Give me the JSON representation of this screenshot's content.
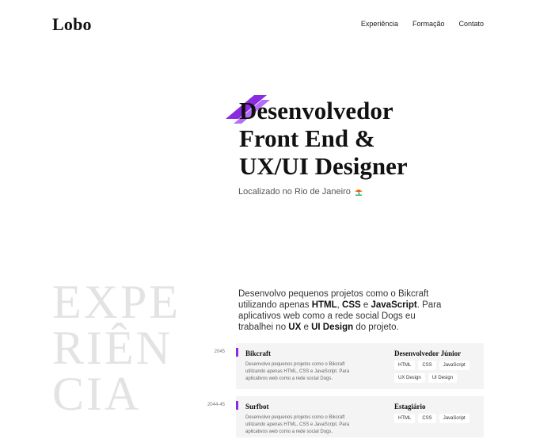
{
  "brand": {
    "logo": "Lobo"
  },
  "nav": {
    "items": [
      "Experiência",
      "Formação",
      "Contato"
    ]
  },
  "hero": {
    "title_lines": [
      "Desenvolvedor",
      "Front End &",
      "UX/UI Designer"
    ],
    "location": "Localizado no Rio de Janeiro",
    "accent_color": "#8a2be2"
  },
  "experience": {
    "heading_lines": [
      "EXPE",
      "RIÊN",
      "CIA"
    ],
    "intro": {
      "p1": "Desenvolvo pequenos projetos como o Bikcraft utilizando apenas ",
      "b1": "HTML",
      "p2": ", ",
      "b2": "CSS",
      "p3": " e ",
      "b3": "JavaScript",
      "p4": ". Para aplicativos web como a rede social Dogs eu trabalhei no ",
      "b4": "UX",
      "p5": " e ",
      "b5": "UI Design",
      "p6": " do projeto."
    },
    "jobs": [
      {
        "year": "2045",
        "company": "Bikcraft",
        "description": "Desenvolvo pequenos projetos como o Bikcraft utilizando apenas HTML, CSS e JavaScript. Para aplicativos web como a rede social Dogs.",
        "role": "Desenvolvedor Júnior",
        "tags": [
          "HTML",
          "CSS",
          "JavaScript",
          "UX Design",
          "UI Design"
        ]
      },
      {
        "year": "2044-45",
        "company": "Surfbot",
        "description": "Desenvolvo pequenos projetos como o Bikcraft utilizando apenas HTML, CSS e JavaScript. Para aplicativos web como a rede social Dogs.",
        "role": "Estagiário",
        "tags": [
          "HTML",
          "CSS",
          "JavaScript"
        ]
      }
    ]
  }
}
